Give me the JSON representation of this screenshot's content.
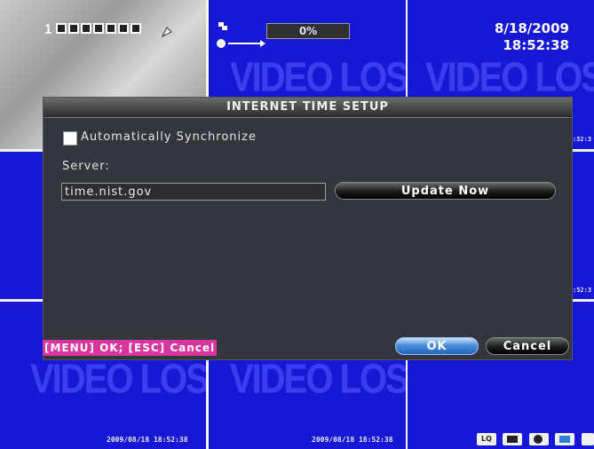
{
  "dialog": {
    "title": "INTERNET TIME SETUP",
    "auto_sync_label": "Automatically Synchronize",
    "server_label": "Server:",
    "server_value": "time.nist.gov",
    "update_button": "Update Now",
    "ok_button": "OK",
    "cancel_button": "Cancel",
    "hint": "[MENU] OK; [ESC] Cancel"
  },
  "channels": {
    "channel_number": "1",
    "progress_text": "0%",
    "progress_value": 0,
    "date": "8/18/2009",
    "time": "18:52:38",
    "video_loss_label": "VIDEO LOSS",
    "side_time": ":52:3",
    "timestamps": [
      "2009/08/18 18:52:38",
      "2009/08/18 18:52:38"
    ],
    "toolbar_icons": [
      "lq-icon",
      "display-icon",
      "record-icon",
      "camera-icon",
      "more-icon"
    ],
    "toolbar_lq": "LQ"
  },
  "colors": {
    "video_bg": "#1717d6",
    "dialog_bg": "#33363d",
    "hint_bg": "#d8369e",
    "ok_button": "#4f8fd8"
  }
}
